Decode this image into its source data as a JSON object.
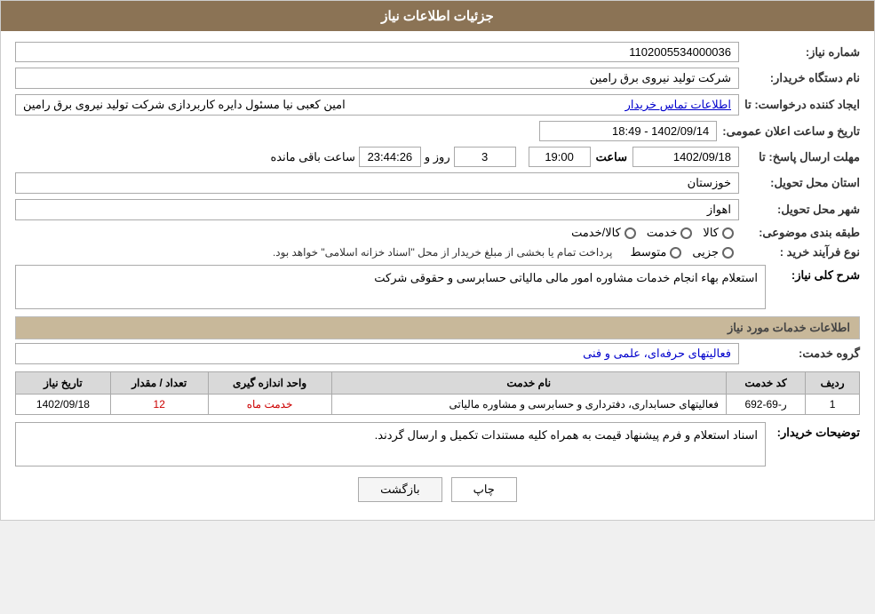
{
  "header": {
    "title": "جزئیات اطلاعات نیاز"
  },
  "fields": {
    "need_number_label": "شماره نیاز:",
    "need_number_value": "1102005534000036",
    "buyer_label": "نام دستگاه خریدار:",
    "buyer_value": "شرکت تولید نیروی برق رامین",
    "creator_label": "ایجاد کننده درخواست: تا",
    "creator_value": "امین کعبی نیا مسئول دایره کاربردازی شرکت تولید نیروی برق رامین",
    "creator_link": "اطلاعات تماس خریدار",
    "announce_date_label": "تاریخ و ساعت اعلان عمومی:",
    "announce_date_value": "1402/09/14 - 18:49",
    "deadline_label": "مهلت ارسال پاسخ: تا",
    "deadline_date": "1402/09/18",
    "deadline_time_label": "ساعت",
    "deadline_time": "19:00",
    "remaining_day_label": "روز و",
    "remaining_day": "3",
    "remaining_time": "23:44:26",
    "remaining_suffix": "ساعت باقی مانده",
    "province_label": "استان محل تحویل:",
    "province_value": "خوزستان",
    "city_label": "شهر محل تحویل:",
    "city_value": "اهواز",
    "category_label": "طبقه بندی موضوعی:",
    "category_options": [
      {
        "label": "کالا",
        "selected": false
      },
      {
        "label": "خدمت",
        "selected": false
      },
      {
        "label": "کالا/خدمت",
        "selected": false
      }
    ],
    "purchase_label": "نوع فرآیند خرید :",
    "purchase_options": [
      {
        "label": "جزیی",
        "selected": false
      },
      {
        "label": "متوسط",
        "selected": false
      }
    ],
    "purchase_note": "پرداخت تمام یا بخشی از مبلغ خریدار از محل \"اسناد خزانه اسلامی\" خواهد بود.",
    "need_desc_label": "شرح کلی نیاز:",
    "need_desc_value": "استعلام بهاء انجام خدمات مشاوره امور مالی مالیاتی حسابرسی و حقوقی شرکت",
    "services_section": "اطلاعات خدمات مورد نیاز",
    "service_group_label": "گروه خدمت:",
    "service_group_value": "فعالیتهای حرفه‌ای، علمی و فنی",
    "table": {
      "columns": [
        "ردیف",
        "کد خدمت",
        "نام خدمت",
        "واحد اندازه گیری",
        "تعداد / مقدار",
        "تاریخ نیاز"
      ],
      "rows": [
        {
          "row": "1",
          "code": "ر-69-692",
          "name": "فعالیتهای حسابداری، دفترداری و حسابرسی و مشاوره مالیاتی",
          "unit": "خدمت ماه",
          "count": "12",
          "date": "1402/09/18"
        }
      ]
    },
    "buyer_desc_label": "توضیحات خریدار:",
    "buyer_desc_value": "اسناد استعلام و فرم پیشنهاد قیمت به همراه کلیه مستندات تکمیل و ارسال گردند."
  },
  "buttons": {
    "print": "چاپ",
    "back": "بازگشت"
  },
  "colors": {
    "header_bg": "#8b7355",
    "section_bg": "#c8b89a",
    "link": "#0000cc",
    "count_red": "#cc0000"
  }
}
